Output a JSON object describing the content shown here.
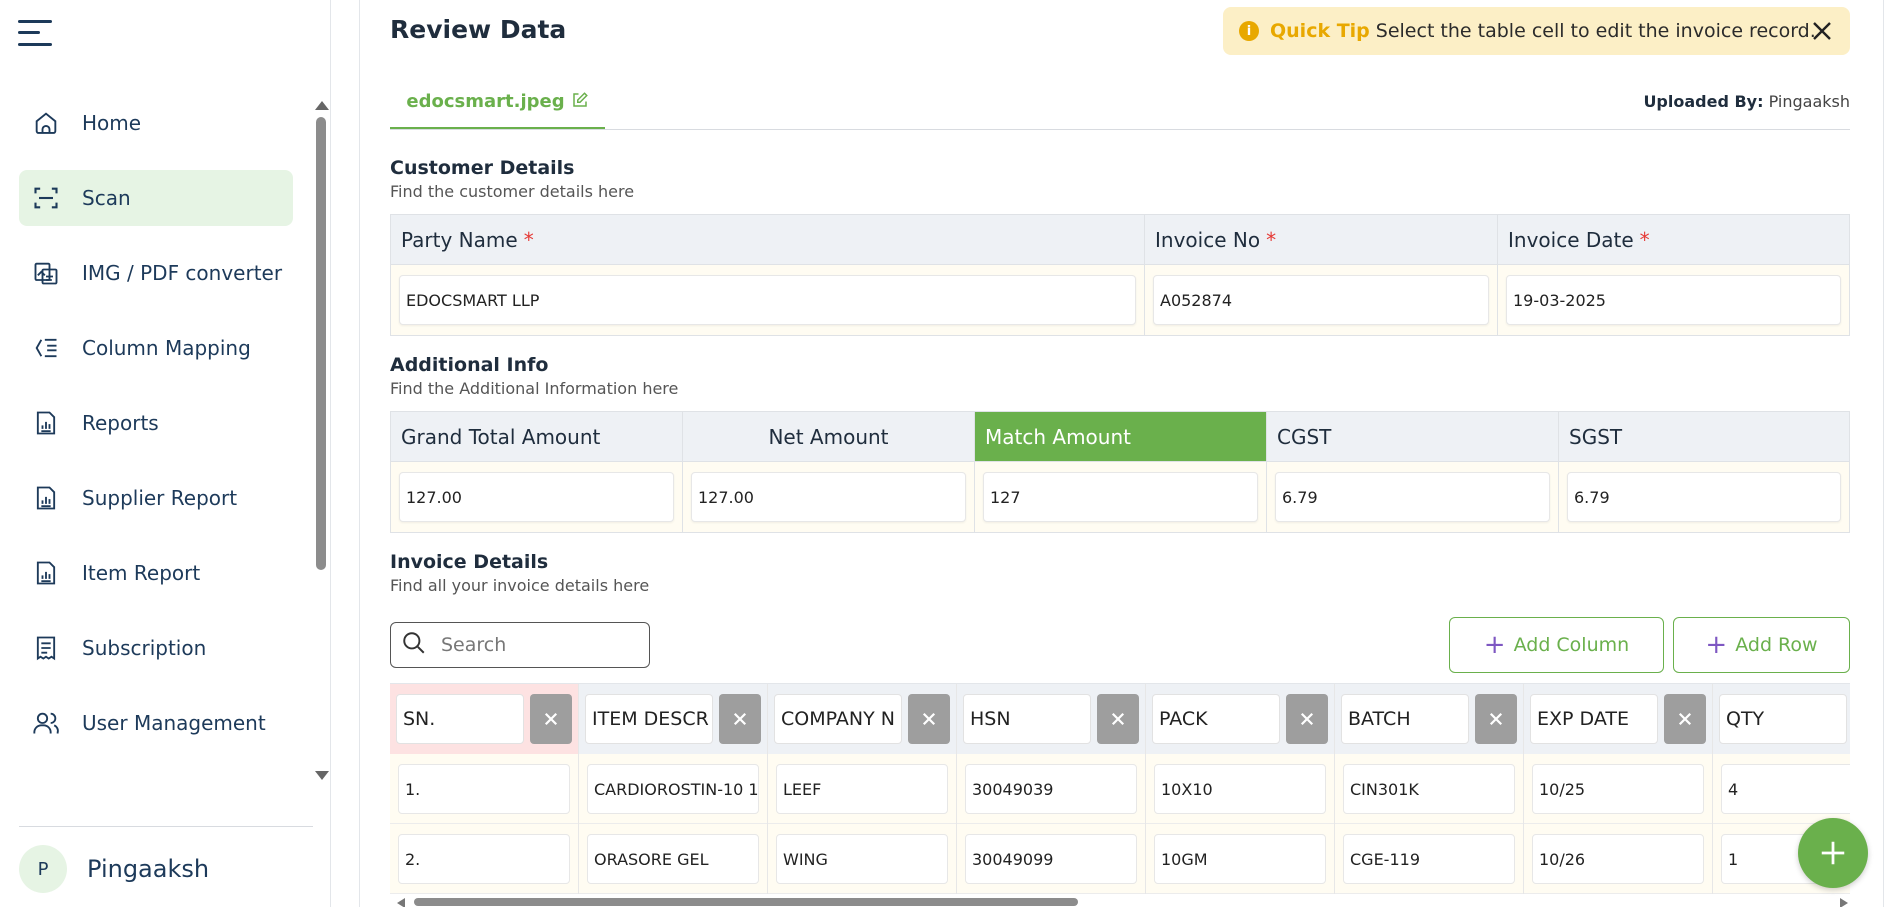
{
  "sidebar": {
    "items": [
      {
        "label": "Home",
        "icon": "home-icon"
      },
      {
        "label": "Scan",
        "icon": "scan-icon",
        "active": true
      },
      {
        "label": "IMG / PDF converter",
        "icon": "file-convert-icon"
      },
      {
        "label": "Column Mapping",
        "icon": "column-mapping-icon"
      },
      {
        "label": "Reports",
        "icon": "chart-icon"
      },
      {
        "label": "Supplier Report",
        "icon": "chart-icon"
      },
      {
        "label": "Item Report",
        "icon": "chart-icon"
      },
      {
        "label": "Subscription",
        "icon": "receipt-icon"
      },
      {
        "label": "User Management",
        "icon": "users-icon"
      }
    ],
    "user": {
      "initial": "P",
      "name": "Pingaaksh"
    }
  },
  "header": {
    "title": "Review Data",
    "tip_label": "Quick Tip",
    "tip_text": "Select the table cell to edit the invoice record.",
    "file_name": "edocsmart.jpeg",
    "uploaded_label": "Uploaded By:",
    "uploaded_by": "Pingaaksh"
  },
  "customer": {
    "title": "Customer Details",
    "subtitle": "Find the customer details here",
    "party_name_label": "Party Name",
    "party_name": "EDOCSMART LLP",
    "invoice_no_label": "Invoice No",
    "invoice_no": "A052874",
    "invoice_date_label": "Invoice Date",
    "invoice_date": "19-03-2025",
    "required_mark": "*"
  },
  "additional": {
    "title": "Additional Info",
    "subtitle": "Find the Additional Information here",
    "grand_total_label": "Grand Total Amount",
    "grand_total": "127.00",
    "net_amount_label": "Net Amount",
    "net_amount": "127.00",
    "match_amount_label": "Match Amount",
    "match_amount": "127",
    "cgst_label": "CGST",
    "cgst": "6.79",
    "sgst_label": "SGST",
    "sgst": "6.79"
  },
  "invoice": {
    "title": "Invoice Details",
    "subtitle": "Find all your invoice details here",
    "search_placeholder": "Search",
    "add_column_label": "Add Column",
    "add_row_label": "Add Row",
    "columns": [
      "SN.",
      "ITEM DESCR",
      "COMPANY N",
      "HSN",
      "PACK",
      "BATCH",
      "EXP DATE",
      "QTY"
    ],
    "rows": [
      [
        "1.",
        "CARDIOROSTIN-10 1",
        "LEEF",
        "30049039",
        "10X10",
        "CIN301K",
        "10/25",
        "4"
      ],
      [
        "2.",
        "ORASORE GEL",
        "WING",
        "30049099",
        "10GM",
        "CGE-119",
        "10/26",
        "1"
      ]
    ]
  },
  "colors": {
    "accent": "#6ab04c",
    "tip_bg": "#fcefc6",
    "tip_accent": "#e8a800",
    "required": "#e53935",
    "nav_text": "#1d3a5a"
  }
}
